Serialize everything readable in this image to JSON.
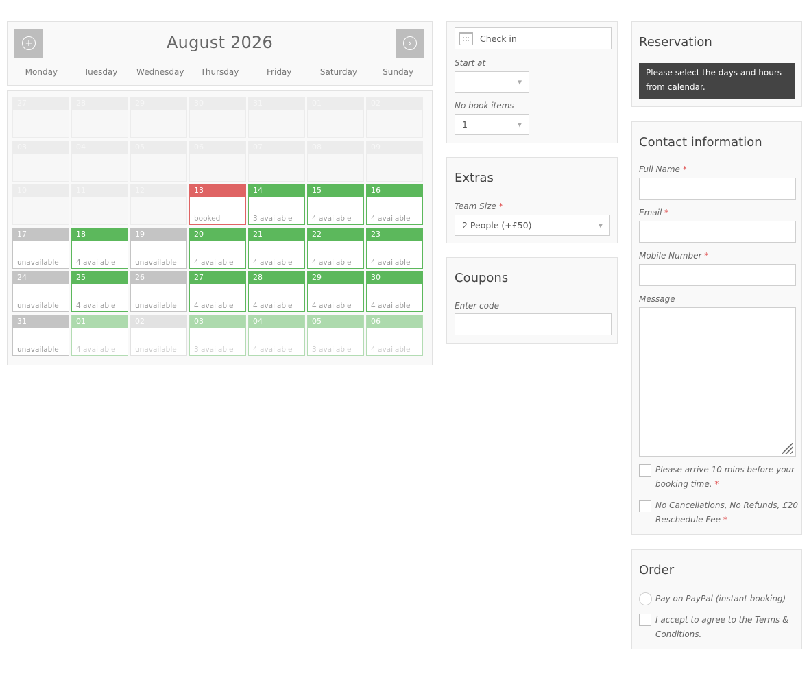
{
  "calendar": {
    "month_title": "August 2026",
    "prev_icon": "plus-circle-icon",
    "next_icon": "chevron-right-circle-icon",
    "weekdays": [
      "Monday",
      "Tuesday",
      "Wednesday",
      "Thursday",
      "Friday",
      "Saturday",
      "Sunday"
    ],
    "days": [
      {
        "num": "27",
        "state": "past",
        "status": ""
      },
      {
        "num": "28",
        "state": "past",
        "status": ""
      },
      {
        "num": "29",
        "state": "past",
        "status": ""
      },
      {
        "num": "30",
        "state": "past",
        "status": ""
      },
      {
        "num": "31",
        "state": "past",
        "status": ""
      },
      {
        "num": "01",
        "state": "past",
        "status": ""
      },
      {
        "num": "02",
        "state": "past",
        "status": ""
      },
      {
        "num": "03",
        "state": "past",
        "status": ""
      },
      {
        "num": "04",
        "state": "past",
        "status": ""
      },
      {
        "num": "05",
        "state": "past",
        "status": ""
      },
      {
        "num": "06",
        "state": "past",
        "status": ""
      },
      {
        "num": "07",
        "state": "past",
        "status": ""
      },
      {
        "num": "08",
        "state": "past",
        "status": ""
      },
      {
        "num": "09",
        "state": "past",
        "status": ""
      },
      {
        "num": "10",
        "state": "past",
        "status": ""
      },
      {
        "num": "11",
        "state": "past",
        "status": ""
      },
      {
        "num": "12",
        "state": "past",
        "status": ""
      },
      {
        "num": "13",
        "state": "booked",
        "status": "booked"
      },
      {
        "num": "14",
        "state": "avail",
        "status": "3 available"
      },
      {
        "num": "15",
        "state": "avail",
        "status": "4 available"
      },
      {
        "num": "16",
        "state": "avail",
        "status": "4 available"
      },
      {
        "num": "17",
        "state": "unavail",
        "status": "unavailable"
      },
      {
        "num": "18",
        "state": "avail",
        "status": "4 available"
      },
      {
        "num": "19",
        "state": "unavail",
        "status": "unavailable"
      },
      {
        "num": "20",
        "state": "avail",
        "status": "4 available"
      },
      {
        "num": "21",
        "state": "avail",
        "status": "4 available"
      },
      {
        "num": "22",
        "state": "avail",
        "status": "4 available"
      },
      {
        "num": "23",
        "state": "avail",
        "status": "4 available"
      },
      {
        "num": "24",
        "state": "unavail",
        "status": "unavailable"
      },
      {
        "num": "25",
        "state": "avail",
        "status": "4 available"
      },
      {
        "num": "26",
        "state": "unavail",
        "status": "unavailable"
      },
      {
        "num": "27",
        "state": "avail",
        "status": "4 available"
      },
      {
        "num": "28",
        "state": "avail",
        "status": "4 available"
      },
      {
        "num": "29",
        "state": "avail",
        "status": "4 available"
      },
      {
        "num": "30",
        "state": "avail",
        "status": "4 available"
      },
      {
        "num": "31",
        "state": "unavail",
        "status": "unavailable"
      },
      {
        "num": "01",
        "state": "fade-avail",
        "status": "4 available"
      },
      {
        "num": "02",
        "state": "fade-unavail",
        "status": "unavailable"
      },
      {
        "num": "03",
        "state": "fade-avail",
        "status": "3 available"
      },
      {
        "num": "04",
        "state": "fade-avail",
        "status": "4 available"
      },
      {
        "num": "05",
        "state": "fade-avail",
        "status": "3 available"
      },
      {
        "num": "06",
        "state": "fade-avail",
        "status": "4 available"
      }
    ],
    "colors": {
      "available": "#5cb85c",
      "booked": "#df6464",
      "unavailable": "#c4c4c4"
    }
  },
  "booking": {
    "checkin_label": "Check in",
    "calendar_icon": "calendar-icon",
    "start_label": "Start at",
    "start_value": "",
    "items_label": "No book items",
    "items_value": "1"
  },
  "extras": {
    "title": "Extras",
    "team_size_label": "Team Size",
    "team_size_value": "2 People (+£50)"
  },
  "coupons": {
    "title": "Coupons",
    "code_label": "Enter code",
    "code_value": ""
  },
  "reservation": {
    "title": "Reservation",
    "message": "Please select the days and hours from calendar."
  },
  "contact": {
    "title": "Contact information",
    "full_name_label": "Full Name",
    "email_label": "Email",
    "mobile_label": "Mobile Number",
    "message_label": "Message",
    "full_name_value": "",
    "email_value": "",
    "mobile_value": "",
    "message_value": "",
    "arrive_label": "Please arrive 10 mins before your booking time.",
    "cancel_label": "No Cancellations, No Refunds, £20 Reschedule Fee",
    "required_mark": "*"
  },
  "order": {
    "title": "Order",
    "paypal_label": "Pay on PayPal (instant booking)",
    "terms_label": "I accept to agree to the Terms & Conditions."
  }
}
